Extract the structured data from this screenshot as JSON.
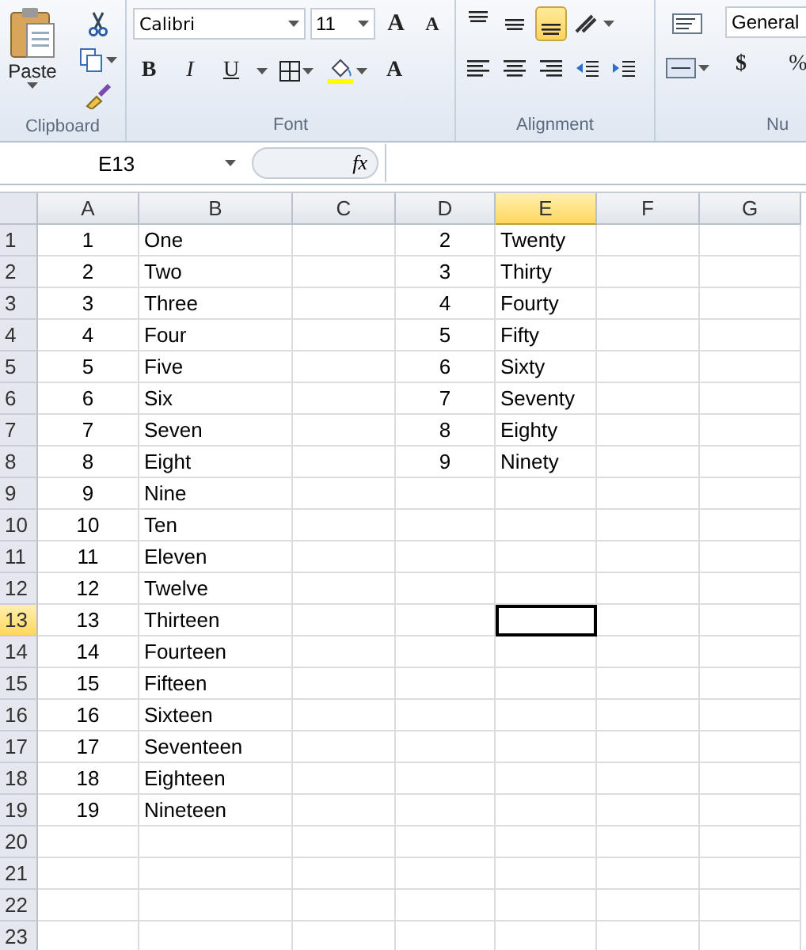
{
  "ribbon": {
    "clipboard": {
      "label": "Clipboard",
      "paste": "Paste"
    },
    "font": {
      "label": "Font",
      "name": "Calibri",
      "size": "11",
      "grow": "A",
      "shrink": "A",
      "bold": "B",
      "italic": "I",
      "underline": "U",
      "color_letter": "A"
    },
    "alignment": {
      "label": "Alignment",
      "vertical": [
        {
          "kind": "top",
          "selected": false
        },
        {
          "kind": "middle",
          "selected": false
        },
        {
          "kind": "bottom",
          "selected": true
        }
      ]
    },
    "number": {
      "label": "Nu",
      "format": "General",
      "currency": "$",
      "percent": "%"
    }
  },
  "formula_bar": {
    "name_box": "E13",
    "fx": "fx"
  },
  "sheet": {
    "columns": [
      {
        "label": "A",
        "kind": "number",
        "selected": false
      },
      {
        "label": "B",
        "kind": "text",
        "selected": false
      },
      {
        "label": "C",
        "kind": "text",
        "selected": false
      },
      {
        "label": "D",
        "kind": "number",
        "selected": false
      },
      {
        "label": "E",
        "kind": "text",
        "selected": true
      },
      {
        "label": "F",
        "kind": "text",
        "selected": false
      },
      {
        "label": "G",
        "kind": "text",
        "selected": false
      }
    ],
    "rows": [
      {
        "header": "1",
        "selected": false,
        "cells": [
          "1",
          "One",
          null,
          "2",
          "Twenty",
          null,
          null
        ]
      },
      {
        "header": "2",
        "selected": false,
        "cells": [
          "2",
          "Two",
          null,
          "3",
          "Thirty",
          null,
          null
        ]
      },
      {
        "header": "3",
        "selected": false,
        "cells": [
          "3",
          "Three",
          null,
          "4",
          "Fourty",
          null,
          null
        ]
      },
      {
        "header": "4",
        "selected": false,
        "cells": [
          "4",
          "Four",
          null,
          "5",
          "Fifty",
          null,
          null
        ]
      },
      {
        "header": "5",
        "selected": false,
        "cells": [
          "5",
          "Five",
          null,
          "6",
          "Sixty",
          null,
          null
        ]
      },
      {
        "header": "6",
        "selected": false,
        "cells": [
          "6",
          "Six",
          null,
          "7",
          "Seventy",
          null,
          null
        ]
      },
      {
        "header": "7",
        "selected": false,
        "cells": [
          "7",
          "Seven",
          null,
          "8",
          "Eighty",
          null,
          null
        ]
      },
      {
        "header": "8",
        "selected": false,
        "cells": [
          "8",
          "Eight",
          null,
          "9",
          "Ninety",
          null,
          null
        ]
      },
      {
        "header": "9",
        "selected": false,
        "cells": [
          "9",
          "Nine",
          null,
          null,
          null,
          null,
          null
        ]
      },
      {
        "header": "10",
        "selected": false,
        "cells": [
          "10",
          "Ten",
          null,
          null,
          null,
          null,
          null
        ]
      },
      {
        "header": "11",
        "selected": false,
        "cells": [
          "11",
          "Eleven",
          null,
          null,
          null,
          null,
          null
        ]
      },
      {
        "header": "12",
        "selected": false,
        "cells": [
          "12",
          "Twelve",
          null,
          null,
          null,
          null,
          null
        ]
      },
      {
        "header": "13",
        "selected": true,
        "cells": [
          "13",
          "Thirteen",
          null,
          null,
          null,
          null,
          null
        ]
      },
      {
        "header": "14",
        "selected": false,
        "cells": [
          "14",
          "Fourteen",
          null,
          null,
          null,
          null,
          null
        ]
      },
      {
        "header": "15",
        "selected": false,
        "cells": [
          "15",
          "Fifteen",
          null,
          null,
          null,
          null,
          null
        ]
      },
      {
        "header": "16",
        "selected": false,
        "cells": [
          "16",
          "Sixteen",
          null,
          null,
          null,
          null,
          null
        ]
      },
      {
        "header": "17",
        "selected": false,
        "cells": [
          "17",
          "Seventeen",
          null,
          null,
          null,
          null,
          null
        ]
      },
      {
        "header": "18",
        "selected": false,
        "cells": [
          "18",
          "Eighteen",
          null,
          null,
          null,
          null,
          null
        ]
      },
      {
        "header": "19",
        "selected": false,
        "cells": [
          "19",
          "Nineteen",
          null,
          null,
          null,
          null,
          null
        ]
      },
      {
        "header": "20",
        "selected": false,
        "cells": [
          null,
          null,
          null,
          null,
          null,
          null,
          null
        ]
      },
      {
        "header": "21",
        "selected": false,
        "cells": [
          null,
          null,
          null,
          null,
          null,
          null,
          null
        ]
      },
      {
        "header": "22",
        "selected": false,
        "cells": [
          null,
          null,
          null,
          null,
          null,
          null,
          null
        ]
      },
      {
        "header": "23",
        "selected": false,
        "cells": [
          null,
          null,
          null,
          null,
          null,
          null,
          null
        ]
      }
    ]
  }
}
